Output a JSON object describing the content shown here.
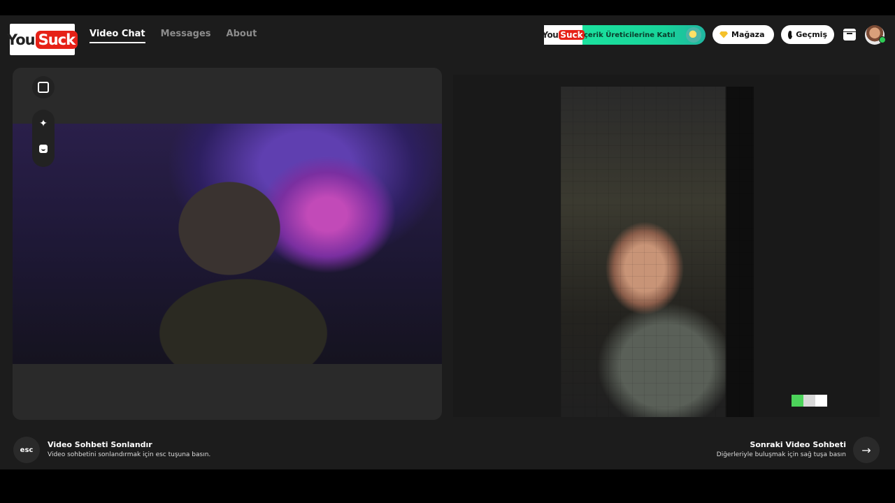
{
  "header": {
    "logo": {
      "you": "You",
      "suck": "Suck"
    },
    "nav": [
      {
        "label": "Video Chat",
        "active": true
      },
      {
        "label": "Messages",
        "active": false
      },
      {
        "label": "About",
        "active": false
      }
    ],
    "promo": {
      "logo_you": "You",
      "logo_suck": "Suck",
      "text": "çerik Üreticilerine Katıl"
    },
    "shop_label": "Mağaza",
    "history_label": "Geçmiş"
  },
  "tools": {
    "expand_icon": "expand-icon",
    "magic_icon": "magic-wand-icon",
    "face_icon": "face-filter-icon"
  },
  "footer": {
    "esc_label": "esc",
    "end_title": "Video Sohbeti Sonlandır",
    "end_hint": "Video sohbetini sonlandırmak için esc tuşuna basın.",
    "next_title": "Sonraki Video Sohbeti",
    "next_hint": "Diğerleriyle buluşmak için sağ tuşa basın",
    "next_icon": "→"
  },
  "colors": {
    "brand_red": "#e62117",
    "promo_green": "#1de9a0",
    "online_green": "#2ecc55",
    "signal": [
      "#4cd35a",
      "#d9d9d9",
      "#ffffff"
    ]
  }
}
